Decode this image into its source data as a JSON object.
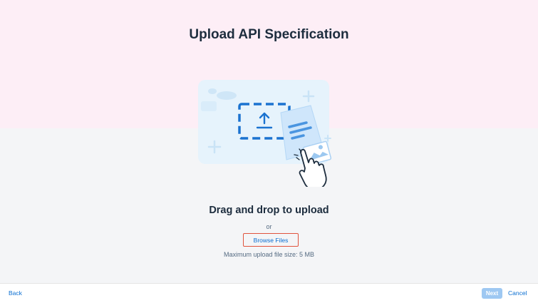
{
  "header": {
    "title": "Upload API Specification"
  },
  "upload": {
    "drop_title": "Drag and drop to upload",
    "or_text": "or",
    "browse_label": "Browse Files",
    "max_size_text": "Maximum upload file size: 5 MB"
  },
  "footer": {
    "back_label": "Back",
    "next_label": "Next",
    "cancel_label": "Cancel"
  },
  "colors": {
    "accent": "#0a6ed1",
    "top_background": "#fdeef6",
    "main_background": "#f4f5f7",
    "highlight_border": "#e0533d",
    "next_disabled": "#9ec8f2"
  },
  "icons": [
    "upload-illustration",
    "upload-arrow-icon",
    "document-icon",
    "image-icon",
    "hand-pointer-icon"
  ]
}
